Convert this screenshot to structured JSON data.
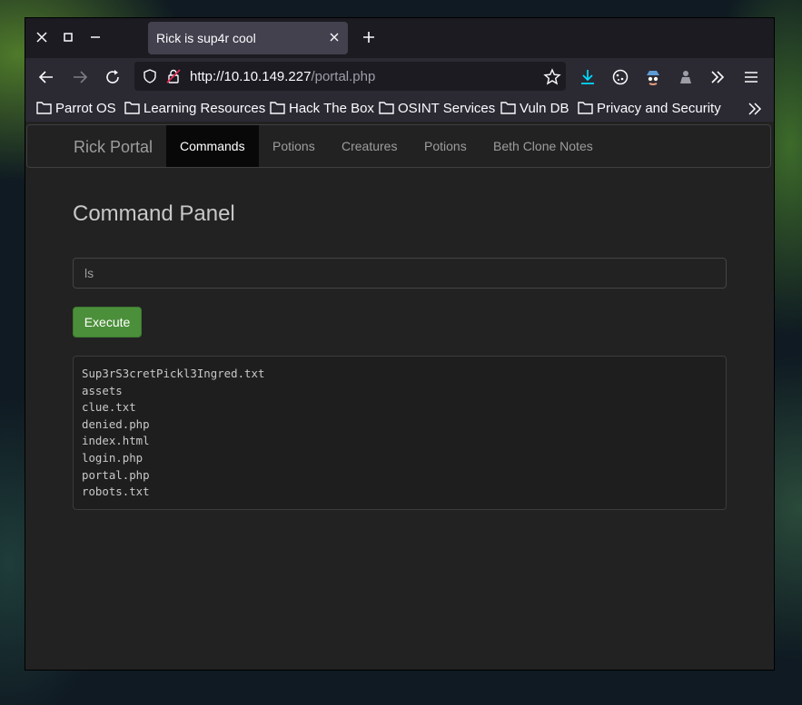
{
  "browser": {
    "tab_title": "Rick is sup4r cool",
    "url_host": "http://10.10.149.227",
    "url_path": "/portal.php",
    "bookmarks": [
      "Parrot OS",
      "Learning Resources",
      "Hack The Box",
      "OSINT Services",
      "Vuln DB",
      "Privacy and Security"
    ]
  },
  "site": {
    "brand": "Rick Portal",
    "nav": [
      "Commands",
      "Potions",
      "Creatures",
      "Potions",
      "Beth Clone Notes"
    ],
    "heading": "Command Panel",
    "command_value": "ls",
    "execute_label": "Execute",
    "output_lines": [
      "Sup3rS3cretPickl3Ingred.txt",
      "assets",
      "clue.txt",
      "denied.php",
      "index.html",
      "login.php",
      "portal.php",
      "robots.txt"
    ]
  },
  "colors": {
    "accent_button": "#4b8f3a",
    "page_bg": "#222222",
    "active_nav": "#080808"
  }
}
